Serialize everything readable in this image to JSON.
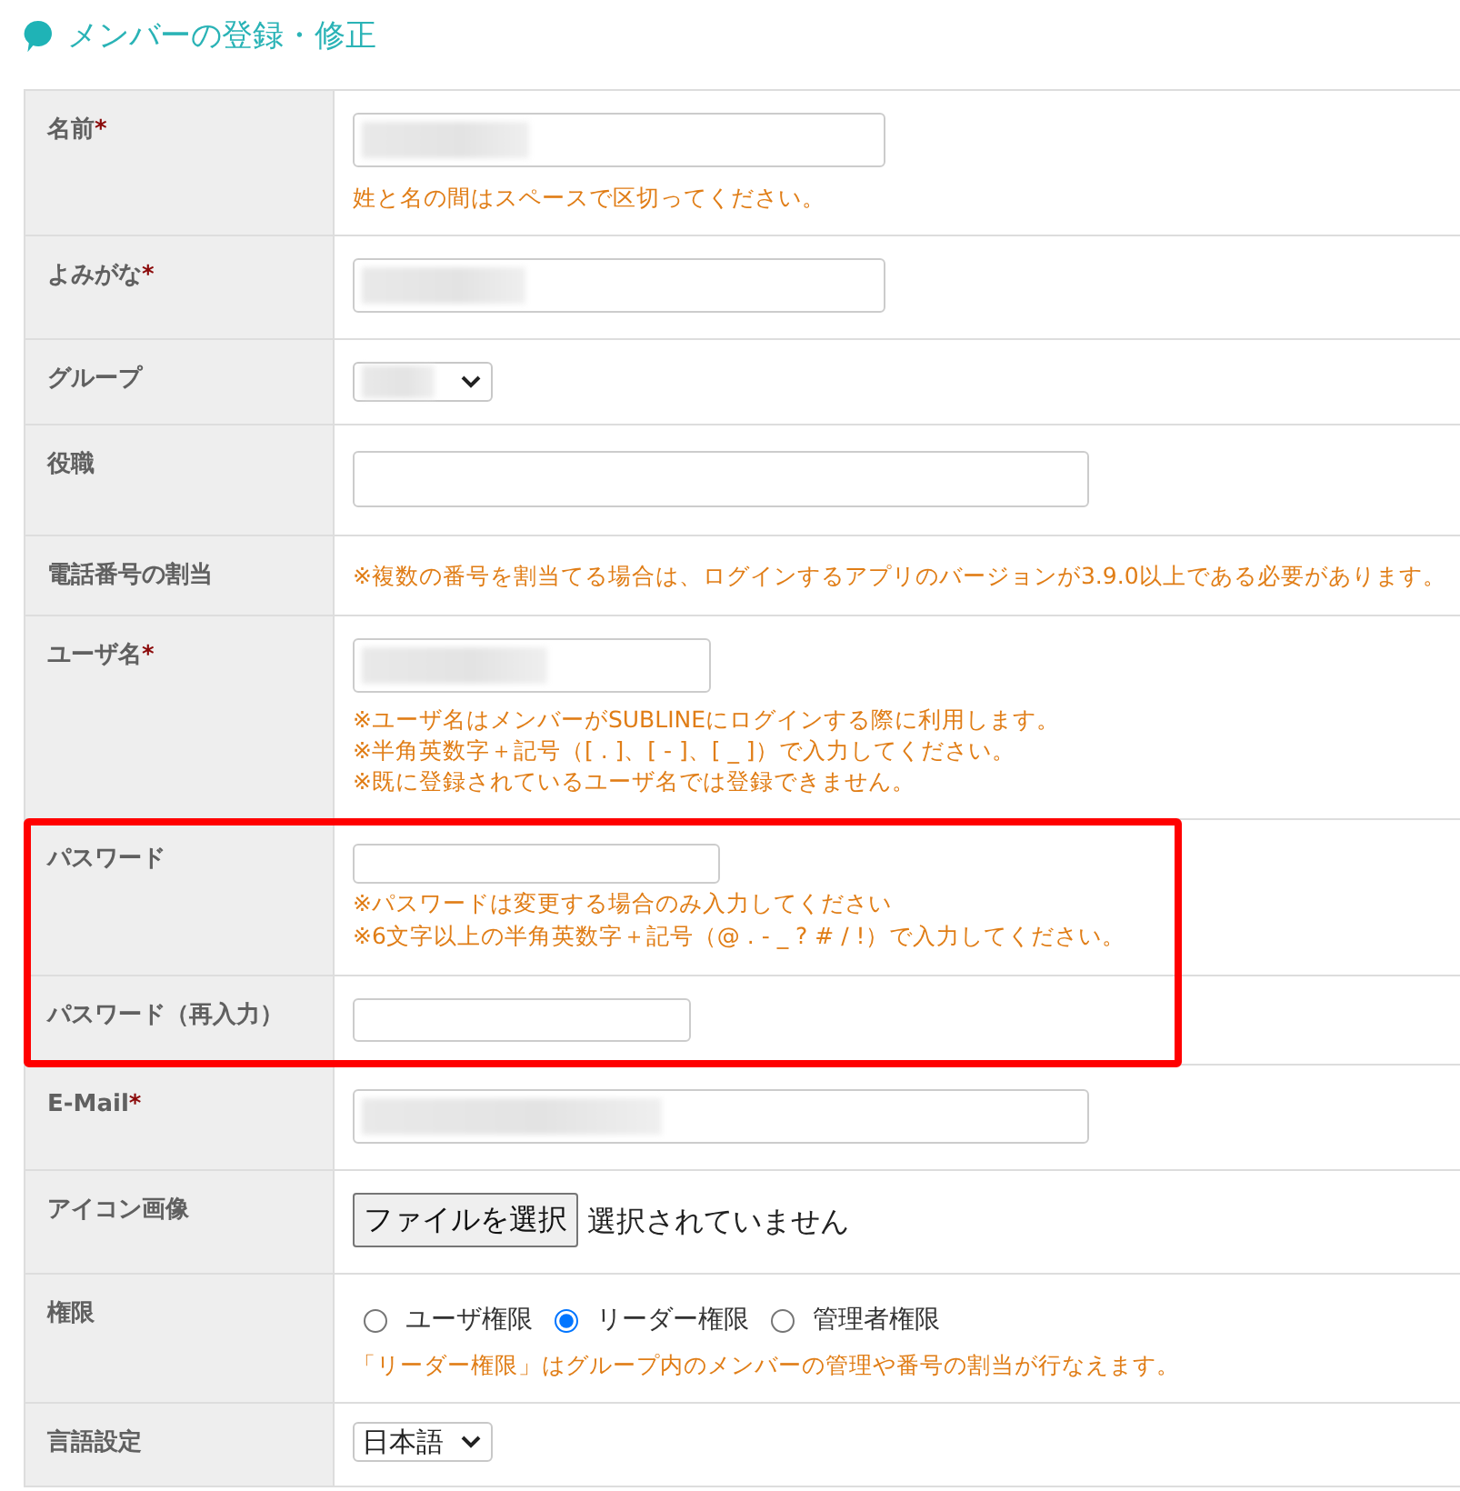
{
  "header": {
    "title": "メンバーの登録・修正"
  },
  "rows": [
    {
      "label": "名前",
      "required_mark": "*",
      "kind": "text",
      "redacted": true,
      "notes": [
        "姓と名の間はスペースで区切ってください。"
      ],
      "highlighted": false
    },
    {
      "label": "よみがな",
      "required_mark": "*",
      "kind": "text",
      "redacted": true,
      "highlighted": false
    },
    {
      "label": "グループ",
      "kind": "select",
      "redacted": true,
      "highlighted": false
    },
    {
      "label": "役職",
      "kind": "text",
      "redacted": false,
      "highlighted": false
    },
    {
      "label": "電話番号の割当",
      "kind": "note",
      "notes": [
        "※複数の番号を割当てる場合は、ログインするアプリのバージョンが3.9.0以上である必要があります。"
      ],
      "highlighted": false
    },
    {
      "label": "ユーザ名",
      "required_mark": "*",
      "kind": "text",
      "redacted": true,
      "notes": [
        "※ユーザ名はメンバーがSUBLINEにログインする際に利用します。",
        "※半角英数字＋記号（[ . ]、[ - ]、[ _ ]）で入力してください。",
        "※既に登録されているユーザ名では登録できません。"
      ],
      "highlighted": false
    },
    {
      "label": "パスワード",
      "kind": "text",
      "redacted": false,
      "notes": [
        "※パスワードは変更する場合のみ入力してください",
        "※6文字以上の半角英数字＋記号（@ . - _ ? # / !）で入力してください。"
      ],
      "highlighted": true
    },
    {
      "label": "パスワード（再入力）",
      "kind": "text",
      "redacted": false,
      "highlighted": true
    },
    {
      "label": "E-Mail",
      "required_mark": "*",
      "kind": "text",
      "redacted": true,
      "highlighted": false
    },
    {
      "label": "アイコン画像",
      "kind": "file",
      "button": "ファイルを選択",
      "status": "選択されていません",
      "highlighted": false
    },
    {
      "label": "権限",
      "kind": "radio",
      "options": [
        {
          "label": "ユーザ権限",
          "selected": false
        },
        {
          "label": "リーダー権限",
          "selected": true
        },
        {
          "label": "管理者権限",
          "selected": false
        }
      ],
      "notes": [
        "「リーダー権限」はグループ内のメンバーの管理や番号の割当が行なえます。"
      ],
      "highlighted": false
    },
    {
      "label": "言語設定",
      "kind": "select",
      "value": "日本語",
      "redacted": false,
      "highlighted": false
    }
  ]
}
